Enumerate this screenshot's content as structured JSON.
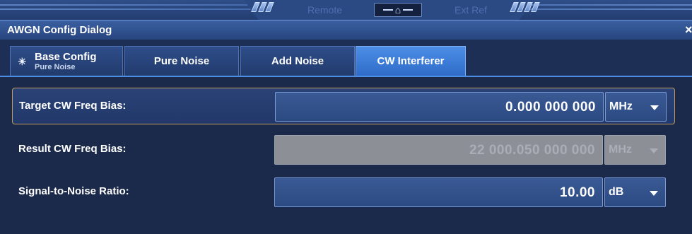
{
  "topbar": {
    "remote_label": "Remote",
    "ext_ref_label": "Ext Ref",
    "home_icon": "home-icon"
  },
  "dialog": {
    "title": "AWGN Config Dialog",
    "close_glyph": "×"
  },
  "tabs": [
    {
      "label": "Base Config",
      "sublabel": "Pure Noise",
      "icon": "sun-icon",
      "active": false
    },
    {
      "label": "Pure Noise",
      "active": false
    },
    {
      "label": "Add Noise",
      "active": false
    },
    {
      "label": "CW Interferer",
      "active": true
    }
  ],
  "rows": [
    {
      "label": "Target CW Freq Bias:",
      "value": "0.000 000 000",
      "unit": "MHz",
      "enabled": true,
      "focused": true
    },
    {
      "label": "Result CW Freq Bias:",
      "value": "22 000.050 000 000",
      "unit": "MHz",
      "enabled": false,
      "focused": false
    },
    {
      "label": "Signal-to-Noise Ratio:",
      "value": "10.00",
      "unit": "dB",
      "enabled": true,
      "focused": false
    }
  ],
  "colors": {
    "accent": "#4c8ee6",
    "focus_border": "#c49a5a",
    "disabled_field": "#8c8f96"
  }
}
